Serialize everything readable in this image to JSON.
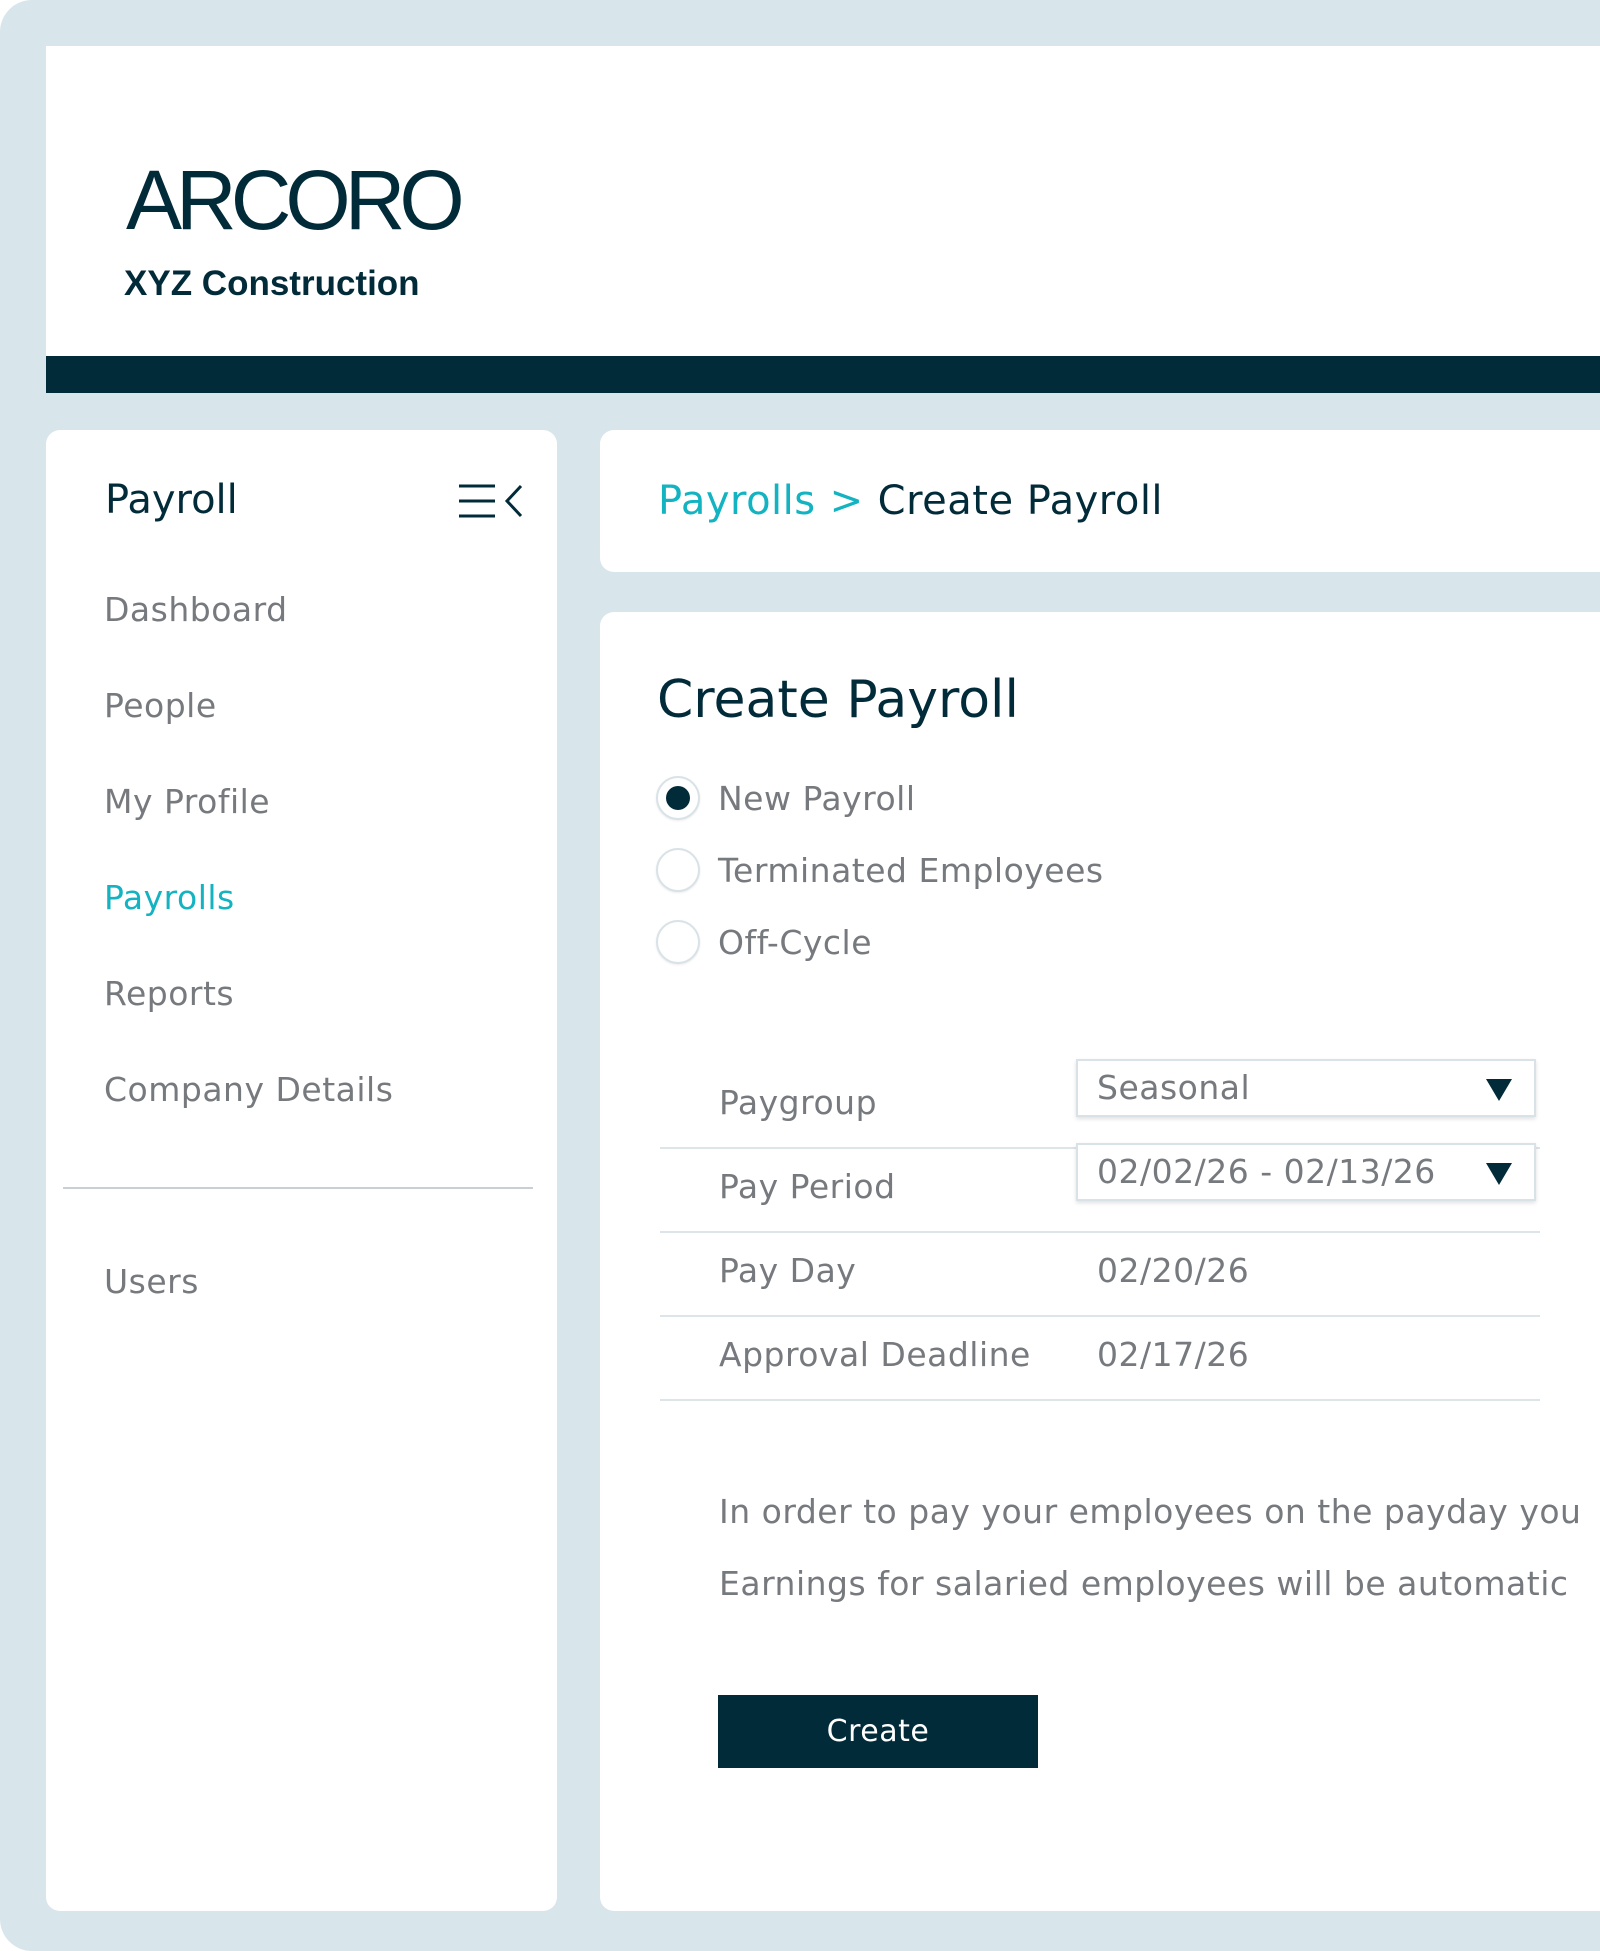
{
  "brand": {
    "logo_text": "ARCORO",
    "company": "XYZ Construction"
  },
  "colors": {
    "navy": "#022b3a",
    "teal": "#13b3c1",
    "frame": "#d8e6ec",
    "muted_text": "#76797d"
  },
  "sidebar": {
    "title": "Payroll",
    "collapse_icon": "menu-collapse-icon",
    "items": [
      {
        "label": "Dashboard",
        "active": false
      },
      {
        "label": "People",
        "active": false
      },
      {
        "label": "My Profile",
        "active": false
      },
      {
        "label": "Payrolls",
        "active": true
      },
      {
        "label": "Reports",
        "active": false
      },
      {
        "label": "Company Details",
        "active": false
      }
    ],
    "secondary_items": [
      {
        "label": "Users",
        "active": false
      }
    ]
  },
  "breadcrumb": {
    "parent": "Payrolls",
    "separator": ">",
    "current": "Create Payroll"
  },
  "main": {
    "title": "Create Payroll",
    "payroll_types": [
      {
        "label": "New Payroll",
        "checked": true
      },
      {
        "label": "Terminated Employees",
        "checked": false
      },
      {
        "label": "Off-Cycle",
        "checked": false
      }
    ],
    "fields": {
      "paygroup": {
        "label": "Paygroup",
        "value": "Seasonal"
      },
      "pay_period": {
        "label": "Pay Period",
        "value": "02/02/26 - 02/13/26"
      },
      "pay_day": {
        "label": "Pay Day",
        "value": "02/20/26"
      },
      "approval_deadline": {
        "label": "Approval Deadline",
        "value": "02/17/26"
      }
    },
    "notes": [
      "In order to pay your employees on the payday you",
      "Earnings for salaried employees will be automatic"
    ],
    "create_label": "Create"
  }
}
